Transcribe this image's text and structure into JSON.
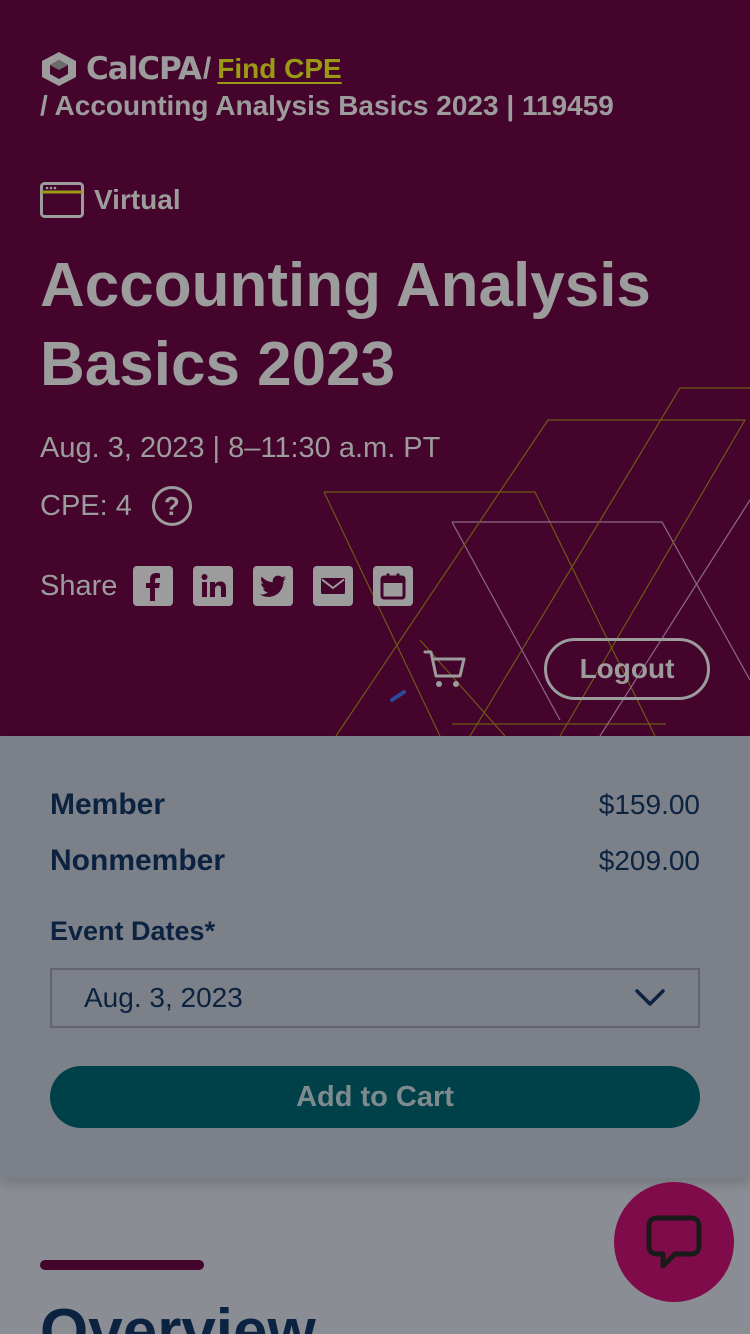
{
  "header": {
    "logo_text": "CalCPA",
    "breadcrumb_separator": "/",
    "breadcrumb_link": "Find CPE",
    "breadcrumb_current": "/ Accounting Analysis Basics 2023 | 119459"
  },
  "event": {
    "format_label": "Virtual",
    "title": "Accounting Analysis Basics 2023",
    "date_time": "Aug. 3, 2023 | 8–11:30 a.m. PT",
    "cpe": "CPE: 4",
    "help_glyph": "?"
  },
  "share": {
    "label": "Share",
    "icons": [
      "facebook-icon",
      "linkedin-icon",
      "twitter-icon",
      "email-icon",
      "calendar-icon"
    ]
  },
  "account": {
    "logout_label": "Logout",
    "cart_icon": "cart-icon"
  },
  "pricing": {
    "member_label": "Member",
    "member_price": "$159.00",
    "nonmember_label": "Nonmember",
    "nonmember_price": "$209.00"
  },
  "event_dates": {
    "label": "Event Dates*",
    "selected": "Aug. 3, 2023"
  },
  "actions": {
    "add_to_cart": "Add to Cart"
  },
  "overview": {
    "heading": "Overview"
  },
  "colors": {
    "hero_bg": "#44042c",
    "accent_link": "#9a9a14",
    "navy_text": "#0b2240",
    "button_teal": "#004048",
    "chat_bg": "#800b4b"
  }
}
